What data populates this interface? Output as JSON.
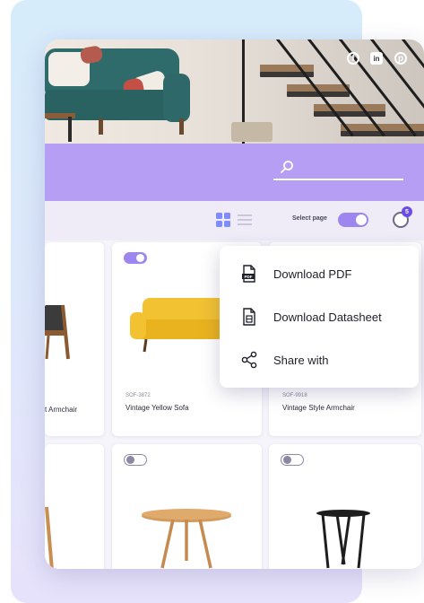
{
  "social": {
    "facebook": "facebook-icon",
    "linkedin": "in",
    "pinterest": "pinterest-icon"
  },
  "toolbar": {
    "select_page_label": "Select page",
    "notification_count": "5"
  },
  "menu": {
    "items": [
      {
        "label": "Download PDF",
        "icon": "pdf-file-icon"
      },
      {
        "label": "Download Datasheet",
        "icon": "datasheet-icon"
      },
      {
        "label": "Share with",
        "icon": "share-icon"
      }
    ]
  },
  "products": [
    {
      "code": "",
      "name": "t Armchair",
      "selected": false
    },
    {
      "code": "SOF-3872",
      "name": "Vintage Yellow Sofa",
      "selected": true
    },
    {
      "code": "SOF-9918",
      "name": "Vintage Style Armchair",
      "selected": false
    },
    {
      "code": "",
      "name": "",
      "selected": false
    },
    {
      "code": "",
      "name": "",
      "selected": false
    },
    {
      "code": "",
      "name": "",
      "selected": false
    }
  ],
  "colors": {
    "accent": "#b59ef4",
    "toggle": "#9d86f0",
    "badge": "#6b4de6",
    "grid_icon": "#7e8cff"
  }
}
